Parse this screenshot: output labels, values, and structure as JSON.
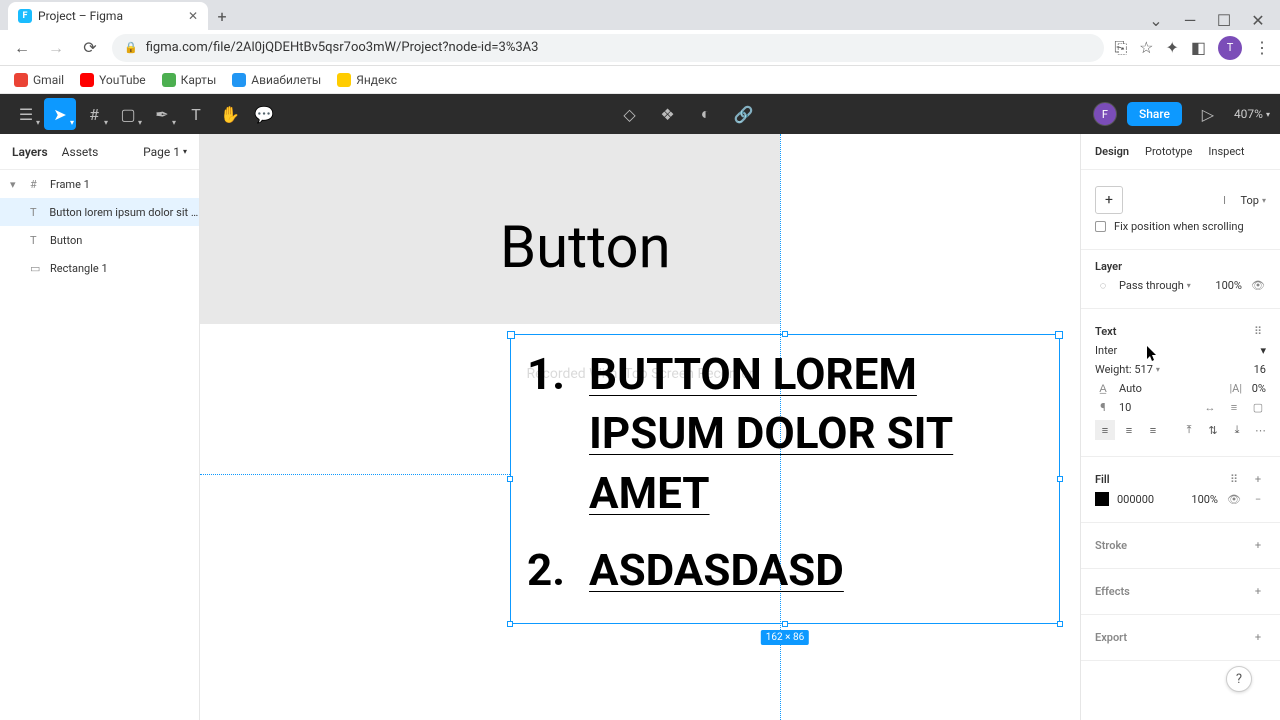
{
  "browser": {
    "tab_title": "Project – Figma",
    "url": "figma.com/file/2Al0jQDEHtBv5qsr7oo3mW/Project?node-id=3%3A3",
    "bookmarks": [
      {
        "label": "Gmail"
      },
      {
        "label": "YouTube"
      },
      {
        "label": "Карты"
      },
      {
        "label": "Авиабилеты"
      },
      {
        "label": "Яндекс"
      }
    ]
  },
  "toolbar": {
    "share_label": "Share",
    "zoom": "407%"
  },
  "left_panel": {
    "tabs": {
      "layers": "Layers",
      "assets": "Assets"
    },
    "page": "Page 1",
    "layers": [
      {
        "name": "Frame 1",
        "type": "frame"
      },
      {
        "name": "Button lorem ipsum dolor sit a...",
        "type": "text",
        "selected": true
      },
      {
        "name": "Button",
        "type": "text"
      },
      {
        "name": "Rectangle 1",
        "type": "rect"
      }
    ]
  },
  "canvas": {
    "button_text": "Button",
    "selected_text": {
      "line1_num": "1.",
      "line1_body": "BUTTON LOREM IPSUM DOLOR SIT AMET",
      "line2_num": "2.",
      "line2_body": "ASDASDASD"
    },
    "watermark": "Recorded With iTop Screen Recorder",
    "dimensions": "162 × 86"
  },
  "right_panel": {
    "tabs": {
      "design": "Design",
      "prototype": "Prototype",
      "inspect": "Inspect"
    },
    "constraints": {
      "vertical": "Top"
    },
    "fix_position": "Fix position when scrolling",
    "layer": {
      "title": "Layer",
      "blend": "Pass through",
      "opacity": "100%"
    },
    "text": {
      "title": "Text",
      "font": "Inter",
      "weight": "Weight: 517",
      "size": "16",
      "line_height": "Auto",
      "letter_spacing": "0%",
      "paragraph_spacing": "10"
    },
    "fill": {
      "title": "Fill",
      "color": "000000",
      "opacity": "100%"
    },
    "stroke": {
      "title": "Stroke"
    },
    "effects": {
      "title": "Effects"
    },
    "export": {
      "title": "Export"
    }
  }
}
